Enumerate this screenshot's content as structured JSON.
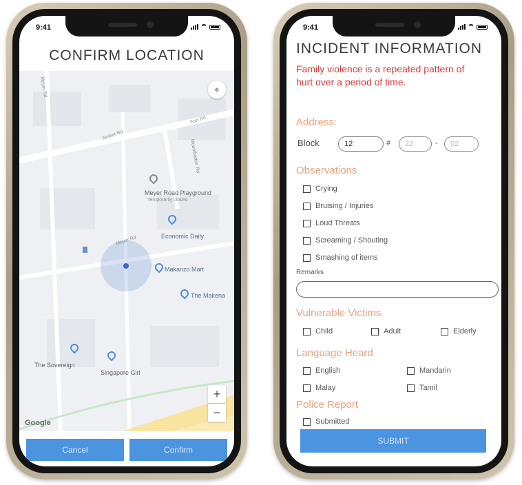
{
  "status_time": "9:41",
  "left_screen": {
    "title": "CONFIRM LOCATION",
    "map": {
      "places": [
        {
          "label": "Meyer Road Playground",
          "sublabel": "Temporarily closed",
          "color": "grey"
        },
        {
          "label": "Economic Daily",
          "color": "blue"
        },
        {
          "label": "Makanzo Mart",
          "color": "blue"
        },
        {
          "label": "The Makena",
          "color": "blue"
        },
        {
          "label": "The Sovereign",
          "color": "blue"
        },
        {
          "label": "Singapore Girl",
          "color": "blue"
        }
      ],
      "streets": [
        "Amber Rd",
        "Meyer Rd",
        "Mountbatten Rd",
        "Fort Rd",
        "Meyer Rd"
      ],
      "zoom_in": "+",
      "zoom_out": "−",
      "attribution": "Google"
    },
    "buttons": {
      "cancel": "Cancel",
      "confirm": "Confirm"
    }
  },
  "right_screen": {
    "title": "INCIDENT INFORMATION",
    "warning": "Family violence is a repeated pattern of hurt over a period of time.",
    "address": {
      "heading": "Address:",
      "block_label": "Block",
      "block_value": "12",
      "hash": "#",
      "floor_placeholder": "22",
      "dash": "-",
      "unit_placeholder": "02"
    },
    "observations": {
      "heading": "Observations",
      "items": [
        "Crying",
        "Bruising / Injuries",
        "Loud Threats",
        "Screaming / Shouting",
        "Smashing of items"
      ],
      "remarks_label": "Remarks"
    },
    "victims": {
      "heading": "Vulnerable Victims",
      "items": [
        "Child",
        "Adult",
        "Elderly"
      ]
    },
    "language": {
      "heading": "Language Heard",
      "items": [
        "English",
        "Mandarin",
        "Malay",
        "Tamil"
      ]
    },
    "police": {
      "heading": "Police Report",
      "items": [
        "Submitted"
      ]
    },
    "submit_label": "SUBMIT"
  },
  "colors": {
    "button_blue": "#4a94e0",
    "warning_red": "#d63a3a",
    "section_orange": "#e9a27e",
    "map_blue_pin": "#4a8ee0"
  }
}
